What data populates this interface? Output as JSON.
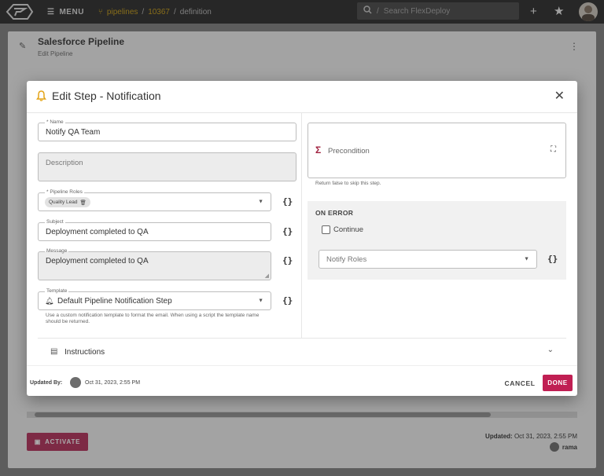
{
  "topbar": {
    "menu_label": "MENU",
    "breadcrumb": [
      "pipelines",
      "10367",
      "definition"
    ],
    "search_placeholder": "Search FlexDeploy",
    "icons": [
      "logo-icon",
      "menu-icon",
      "pipeline-icon",
      "search-icon",
      "add-icon",
      "star-icon",
      "avatar"
    ]
  },
  "page": {
    "title": "Salesforce Pipeline",
    "subtitle": "Edit Pipeline",
    "activate_label": "ACTIVATE",
    "updated_label": "Updated:",
    "updated_date": "Oct 31, 2023, 2:55 PM",
    "updated_user": "rama"
  },
  "dialog": {
    "title": "Edit Step - Notification",
    "name": {
      "label": "* Name",
      "value": "Notify QA Team"
    },
    "description": {
      "placeholder": "Description"
    },
    "pipeline_roles": {
      "label": "* Pipeline Roles",
      "chip": "Quality Lead"
    },
    "subject": {
      "label": "Subject",
      "value": "Deployment completed to QA"
    },
    "message": {
      "label": "Message",
      "value": "Deployment completed to QA"
    },
    "template": {
      "label": "Template",
      "value": "Default Pipeline Notification Step",
      "help": "Use a custom notification template to format the email. When using a script the template name should be returned."
    },
    "braces": "{}",
    "precondition": {
      "label": "Precondition",
      "help": "Return false to skip this step."
    },
    "on_error": {
      "title": "ON ERROR",
      "continue_label": "Continue",
      "continue_checked": false,
      "notify_roles_placeholder": "Notify Roles"
    },
    "instructions_label": "Instructions",
    "updated_by_label": "Updated By:",
    "updated_date": "Oct 31, 2023, 2:55 PM",
    "cancel_label": "CANCEL",
    "done_label": "DONE"
  },
  "colors": {
    "accent": "#c01f53",
    "bell": "#e4a416",
    "topbar": "#3a3a3a",
    "breadcrumb": "#c9a227"
  }
}
